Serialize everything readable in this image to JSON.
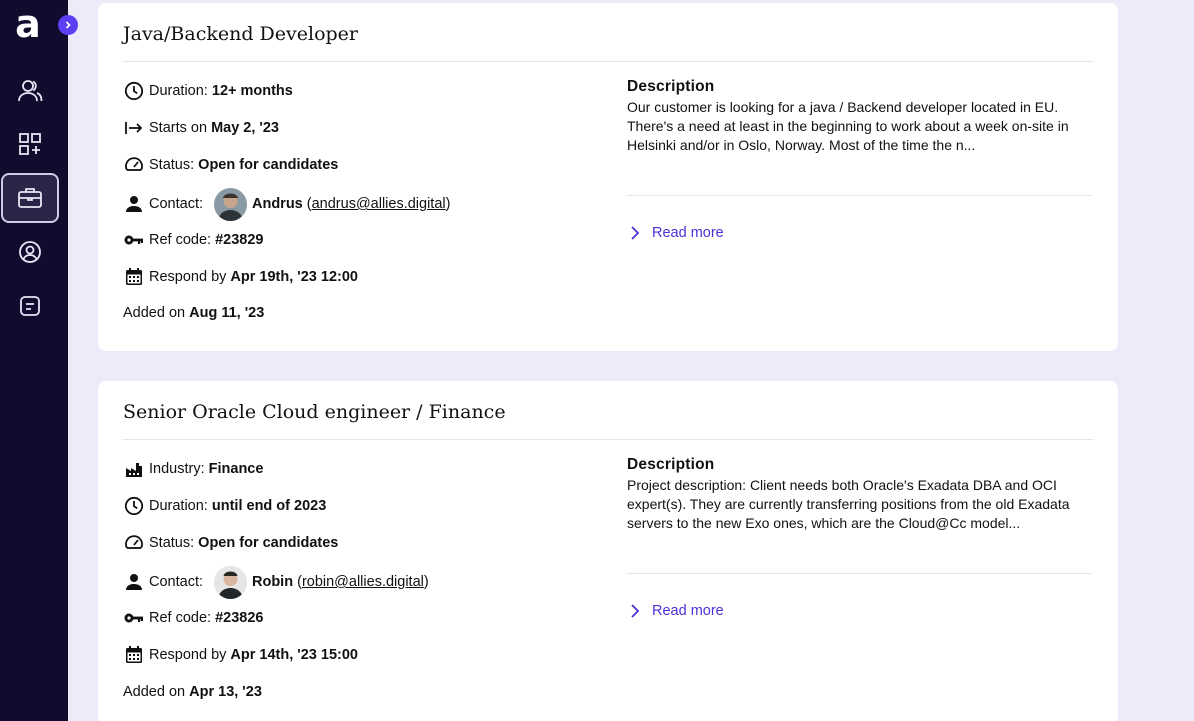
{
  "sidebar": {
    "logo": "a",
    "items": [
      {
        "name": "talents",
        "icon": "people-icon",
        "active": false
      },
      {
        "name": "dashboard",
        "icon": "grid-plus-icon",
        "active": false
      },
      {
        "name": "jobs",
        "icon": "briefcase-icon",
        "active": true
      },
      {
        "name": "profile",
        "icon": "user-circle-icon",
        "active": false
      },
      {
        "name": "notes",
        "icon": "document-icon",
        "active": false
      }
    ]
  },
  "colors": {
    "sidebar_bg": "#120b2e",
    "accent": "#5b3ff2",
    "link": "#4a31d8",
    "page_bg": "#ebebfa"
  },
  "jobs": [
    {
      "title": "Java/Backend Developer",
      "duration_label": "Duration:",
      "duration": "12+ months",
      "starts_label": "Starts on",
      "starts": "May 2, '23",
      "status_label": "Status:",
      "status": "Open for candidates",
      "contact_label": "Contact:",
      "contact_name": "Andrus",
      "contact_email": "andrus@allies.digital",
      "ref_label": "Ref code:",
      "ref": "#23829",
      "respond_label": "Respond by",
      "respond": "Apr 19th, '23 12:00",
      "added_label": "Added on",
      "added": "Aug 11, '23",
      "desc_heading": "Description",
      "desc": "Our customer is looking for a java / Backend developer located in EU. There's a need at least in the beginning to work about a week on-site in Helsinki and/or in Oslo, Norway. Most of the time the n...",
      "read_more": "Read more"
    },
    {
      "title": "Senior Oracle Cloud engineer / Finance",
      "industry_label": "Industry:",
      "industry": "Finance",
      "duration_label": "Duration:",
      "duration": "until end of 2023",
      "status_label": "Status:",
      "status": "Open for candidates",
      "contact_label": "Contact:",
      "contact_name": "Robin",
      "contact_email": "robin@allies.digital",
      "ref_label": "Ref code:",
      "ref": "#23826",
      "respond_label": "Respond by",
      "respond": "Apr 14th, '23 15:00",
      "added_label": "Added on",
      "added": "Apr 13, '23",
      "desc_heading": "Description",
      "desc": "Project description: Client needs both Oracle's Exadata DBA and OCI expert(s). They are currently transferring positions from the old Exadata servers to the new Exo ones, which are the Cloud@Cc model...",
      "read_more": "Read more"
    }
  ]
}
